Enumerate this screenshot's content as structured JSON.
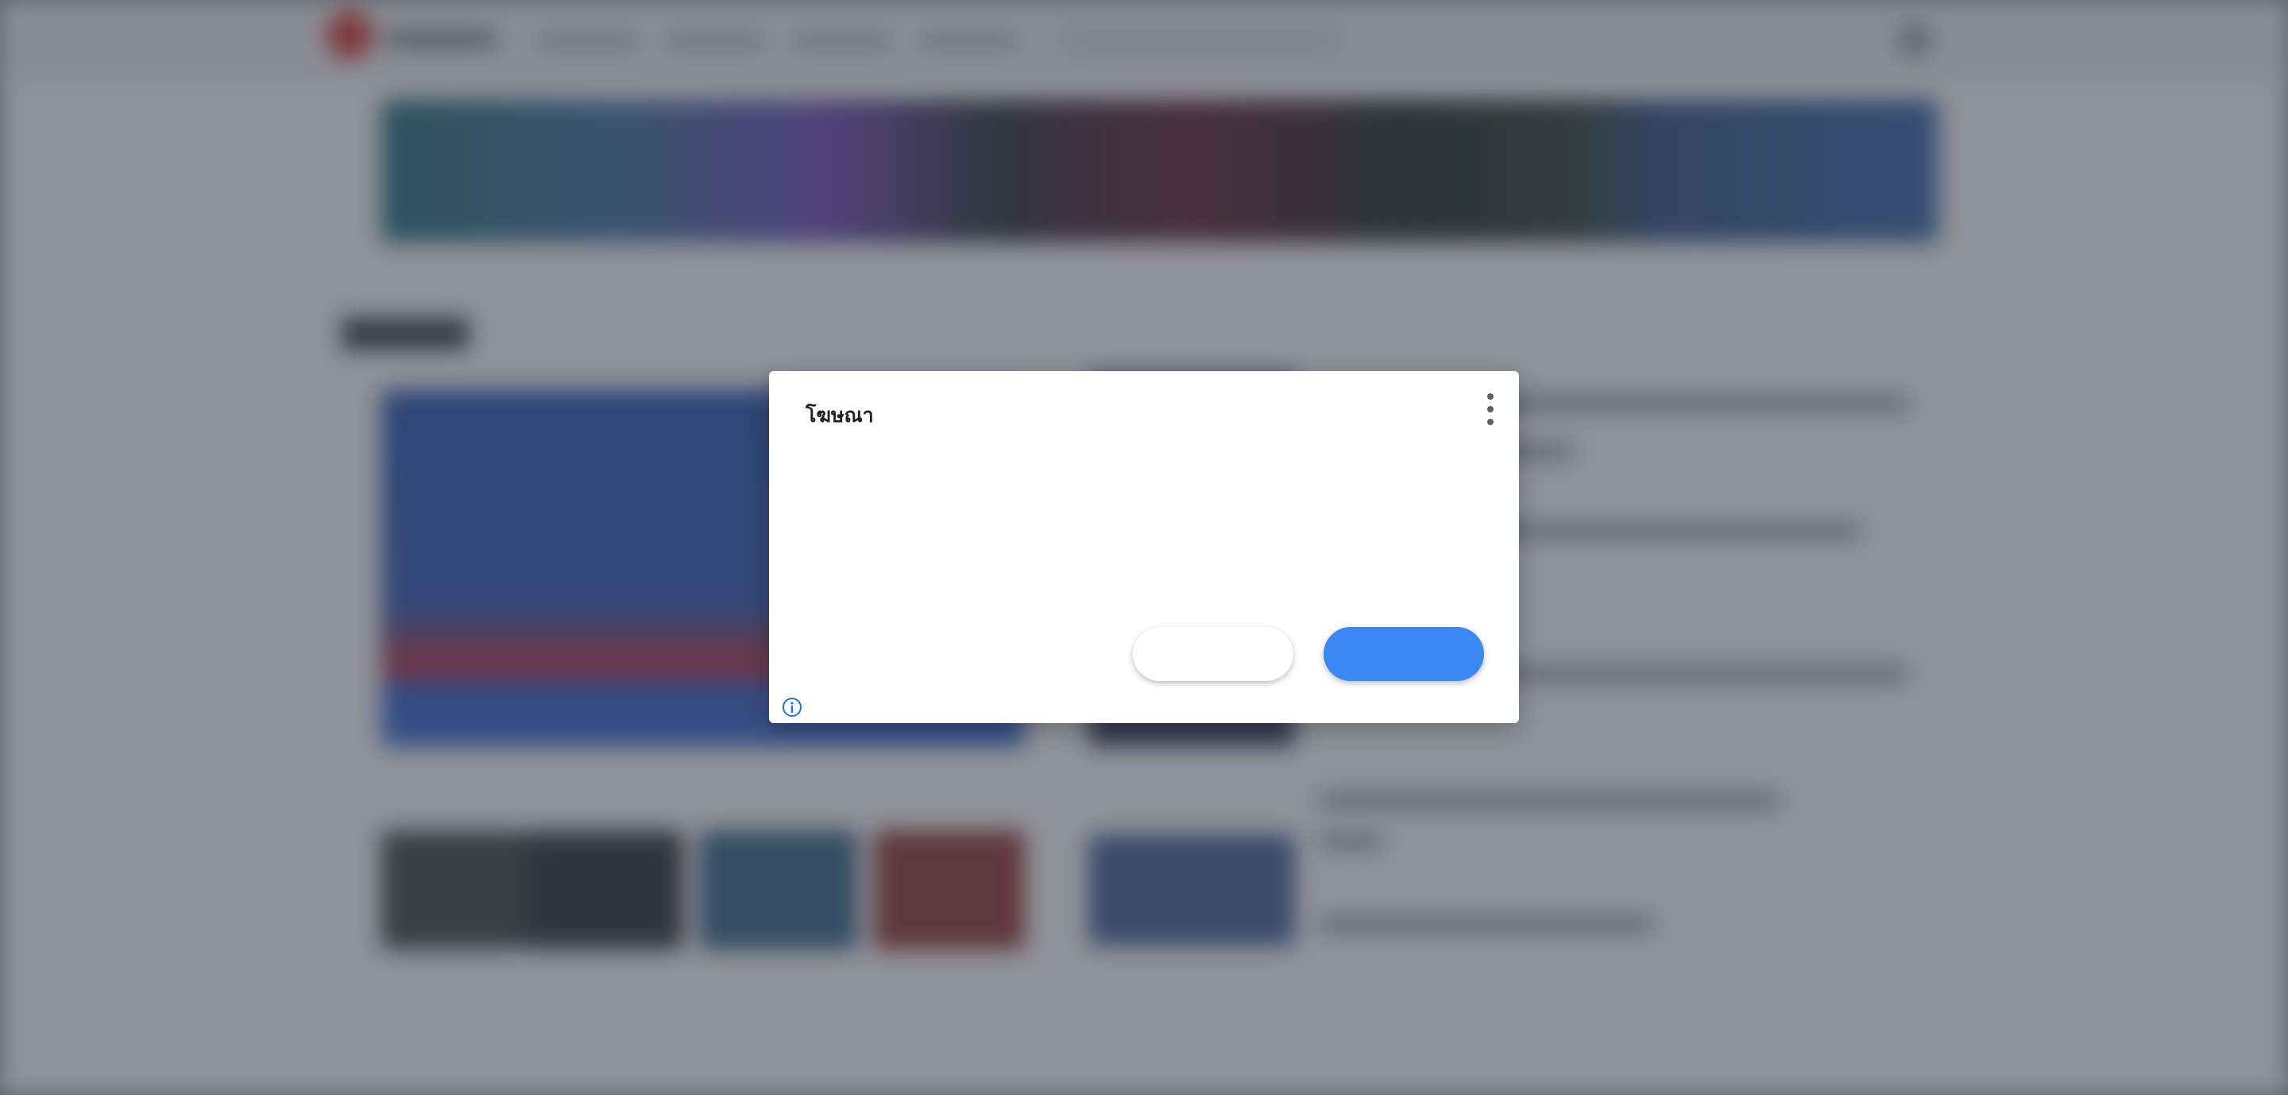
{
  "dialog": {
    "title": "โฆษณา",
    "menu_icon": "more-vert-icon",
    "secondary_button_label": "",
    "primary_button_label": "",
    "info_icon": "info-icon"
  },
  "colors": {
    "primary_button": "#3b88f5",
    "info_icon": "#1a73e8",
    "overlay": "#7e8187"
  }
}
